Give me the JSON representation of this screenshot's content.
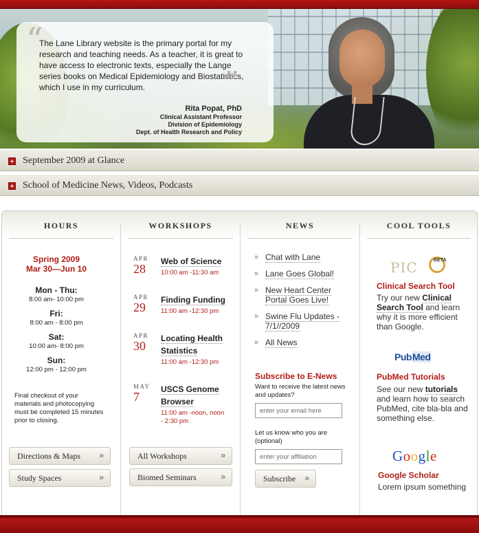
{
  "hero": {
    "quote": "The Lane Library website is the primary portal for my research and teaching needs. As a teacher, it is great to have access to electronic texts, especially the Lange series books on Medical Epidemiology and Biostatistics, which I use in my curriculum.",
    "name": "Rita Popat, PhD",
    "title_lines": [
      "Clinical Assistant Professor",
      "Division of Epidemiology",
      "Dept. of Health Research and Policy"
    ]
  },
  "bars": [
    {
      "label": "September 2009 at Glance"
    },
    {
      "label": "School of Medicine News, Videos, Podcasts"
    }
  ],
  "hours": {
    "title": "HOURS",
    "season": "Spring 2009",
    "range": "Mar 30—Jun 10",
    "days": [
      {
        "day": "Mon - Thu:",
        "time": "8:00 am- 10:00 pm"
      },
      {
        "day": "Fri:",
        "time": "8:00 am - 8:00 pm"
      },
      {
        "day": "Sat:",
        "time": "10:00 am- 8:00 pm"
      },
      {
        "day": "Sun:",
        "time": "12:00 pm - 12:00 pm"
      }
    ],
    "note": "Final checkout of your materials and photocopying must be completed 15 minutes prior to closing.",
    "buttons": [
      "Directions & Maps",
      "Study Spaces"
    ]
  },
  "workshops": {
    "title": "WORKSHOPS",
    "items": [
      {
        "month": "APR",
        "day": "28",
        "title": "Web of Science",
        "time": "10:00 am -11:30 am"
      },
      {
        "month": "APR",
        "day": "29",
        "title": "Finding Funding",
        "time": "11:00 am -12:30 pm"
      },
      {
        "month": "APR",
        "day": "30",
        "title": "Locating Health Statistics",
        "time": "11:00 am -12:30 pm"
      },
      {
        "month": "MAY",
        "day": "7",
        "title": "USCS Genome Browser",
        "time": "11:00 am -noon, noon - 2:30 pm"
      }
    ],
    "buttons": [
      "All Workshops",
      "Biomed Seminars"
    ]
  },
  "news": {
    "title": "NEWS",
    "items": [
      "Chat with Lane",
      "Lane Goes Global!",
      "New Heart Center Portal Goes Live!",
      "Swine Flu Updates - 7/1//2009",
      "All News"
    ],
    "subscribe_title": "Subscribe to E-News",
    "subscribe_prompt": "Want to receive the latest news and updates?",
    "email_placeholder": "enter your email here",
    "who_prompt": "Let us know who you are (optional)",
    "affiliation_placeholder": "enter your affiliation",
    "subscribe_button": "Subscribe"
  },
  "cool_tools": {
    "title": "COOL TOOLS",
    "pic_logo": "PIC",
    "pic_beta": "BETA",
    "clinical_title": "Clinical Search Tool",
    "clinical_pre": "Try our new ",
    "clinical_bold": "Clinical Search Tool",
    "clinical_post": " and learn why it is more efficient than Google.",
    "pubmed_logo_a": "Pub",
    "pubmed_logo_b": "Med",
    "pubmed_title": "PubMed Tutorials",
    "pubmed_pre": "See our new ",
    "pubmed_bold": "tutorials",
    "pubmed_post": " and learn how to search PubMed, cite bla-bla and something else.",
    "google_letters": [
      "G",
      "o",
      "o",
      "g",
      "l",
      "e"
    ],
    "google_title": "Google Scholar",
    "google_text": "Lorem ipsum something"
  },
  "colors": {
    "accent": "#b01d17",
    "bar": "#8a0d0d",
    "google": [
      "#1a52c7",
      "#d6251b",
      "#f2b01c",
      "#1a52c7",
      "#2a9b35",
      "#d6251b"
    ]
  },
  "icons": {
    "quote_open": "“",
    "quote_close": "”",
    "arrow": "»"
  }
}
